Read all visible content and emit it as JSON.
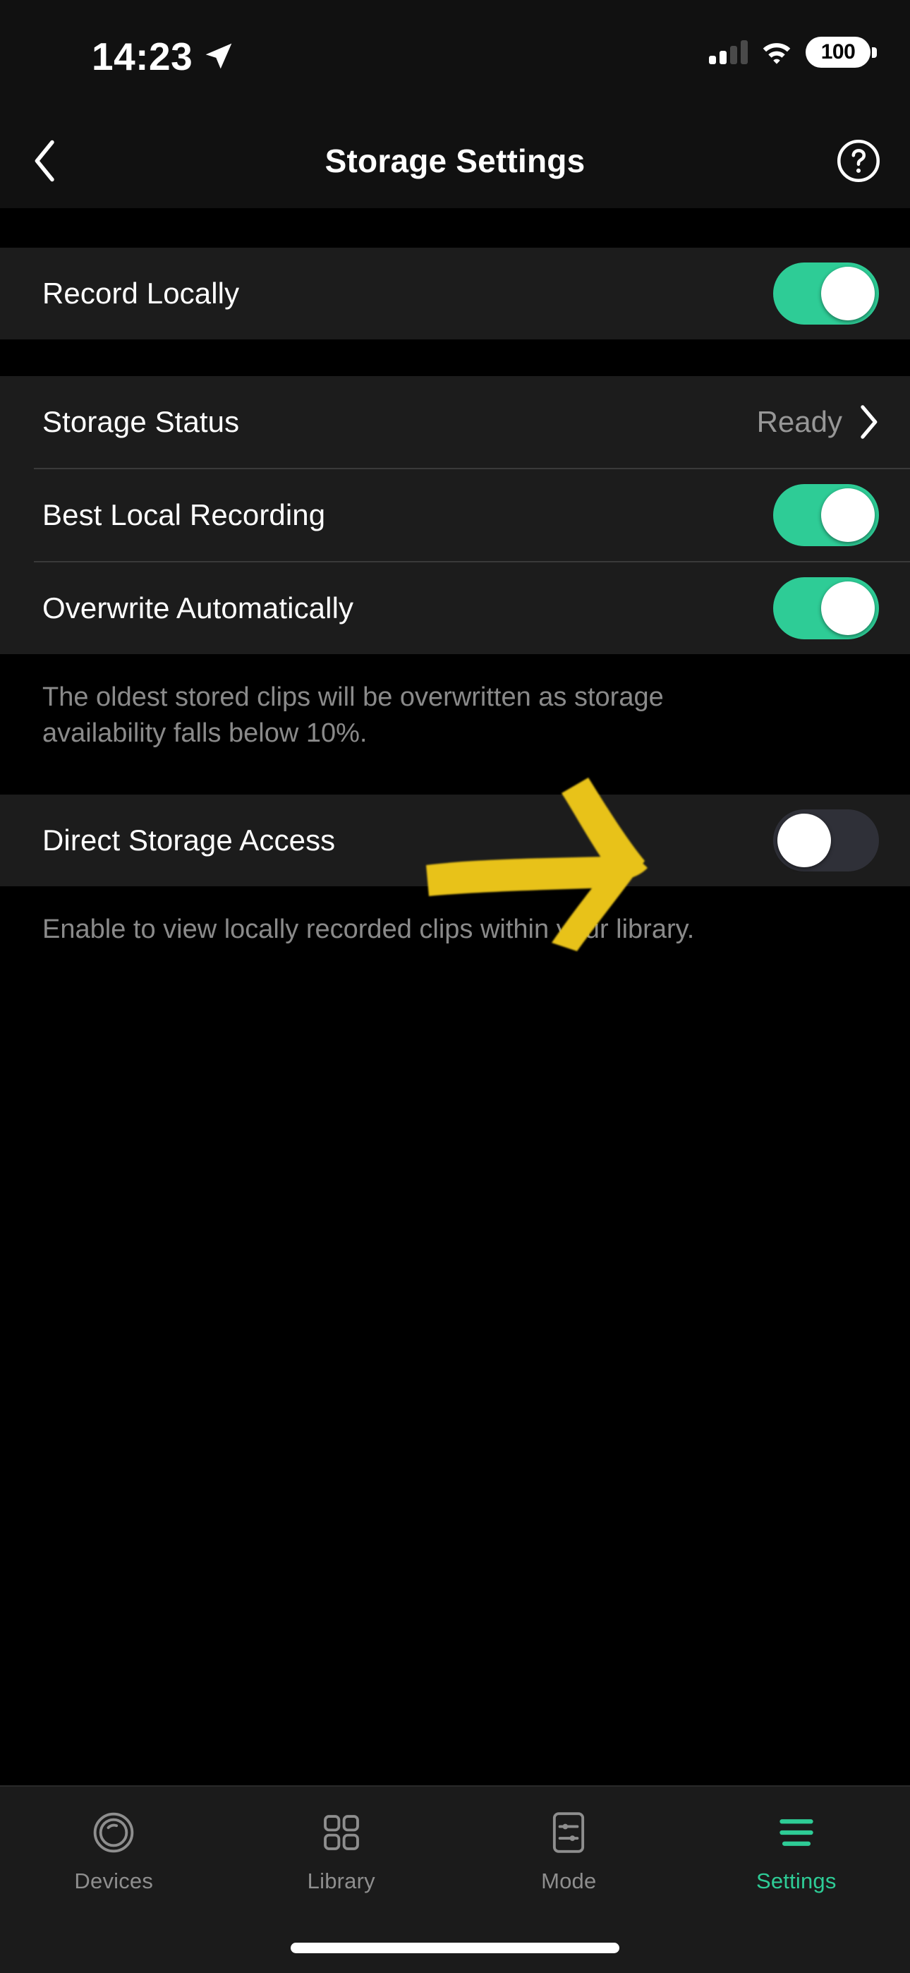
{
  "status_bar": {
    "time": "14:23",
    "location_icon": "location-arrow-icon",
    "cellular_icon": "cellular-signal-icon",
    "wifi_icon": "wifi-icon",
    "battery_percent": "100"
  },
  "header": {
    "back_icon": "chevron-left-icon",
    "title": "Storage Settings",
    "help_icon": "help-circle-icon"
  },
  "sections": [
    {
      "rows": [
        {
          "label": "Record Locally",
          "type": "toggle",
          "value": "on"
        }
      ],
      "footer": ""
    },
    {
      "rows": [
        {
          "label": "Storage Status",
          "type": "disclosure",
          "value": "Ready"
        },
        {
          "label": "Best Local Recording",
          "type": "toggle",
          "value": "on"
        },
        {
          "label": "Overwrite Automatically",
          "type": "toggle",
          "value": "on"
        }
      ],
      "footer": "The oldest stored clips will be overwritten as storage availability falls below 10%."
    },
    {
      "rows": [
        {
          "label": "Direct Storage Access",
          "type": "toggle",
          "value": "off"
        }
      ],
      "footer": "Enable to view locally recorded clips within your library."
    }
  ],
  "annotation": {
    "icon": "arrow-annotation",
    "color": "#e8c219",
    "points_to": "Direct Storage Access toggle"
  },
  "tab_bar": {
    "items": [
      {
        "label": "Devices",
        "icon": "camera-lens-icon",
        "active": false
      },
      {
        "label": "Library",
        "icon": "grid-2x2-icon",
        "active": false
      },
      {
        "label": "Mode",
        "icon": "sliders-panel-icon",
        "active": false
      },
      {
        "label": "Settings",
        "icon": "menu-lines-icon",
        "active": true
      }
    ]
  },
  "colors": {
    "accent_green": "#2ecc96",
    "toggle_off_track": "#2f3038",
    "row_background": "#1c1c1c",
    "page_background": "#000000",
    "secondary_text": "#8a8a8a",
    "annotation_yellow": "#e8c219"
  }
}
